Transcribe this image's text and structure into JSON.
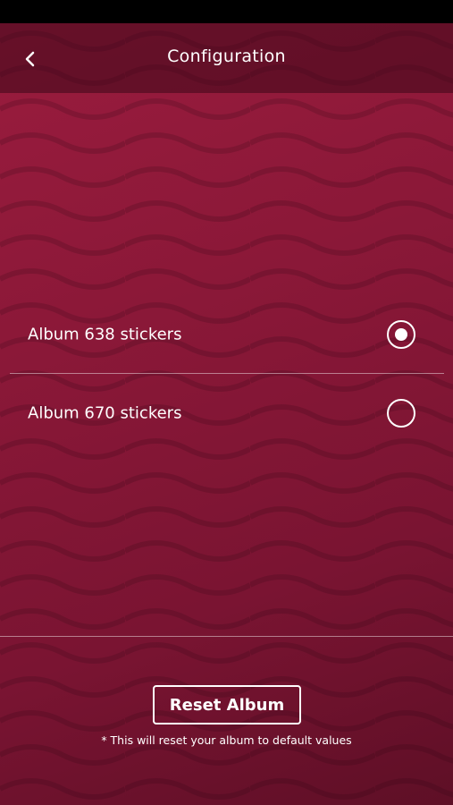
{
  "header": {
    "title": "Configuration",
    "back_icon": "chevron-left-icon"
  },
  "options": [
    {
      "label": "Album 638 stickers",
      "selected": true
    },
    {
      "label": "Album 670 stickers",
      "selected": false
    }
  ],
  "reset": {
    "button_label": "Reset Album",
    "note": "* This will reset your album to default values"
  },
  "colors": {
    "background": "#8b1838",
    "header": "#4a0a1e",
    "text": "#ffffff"
  }
}
